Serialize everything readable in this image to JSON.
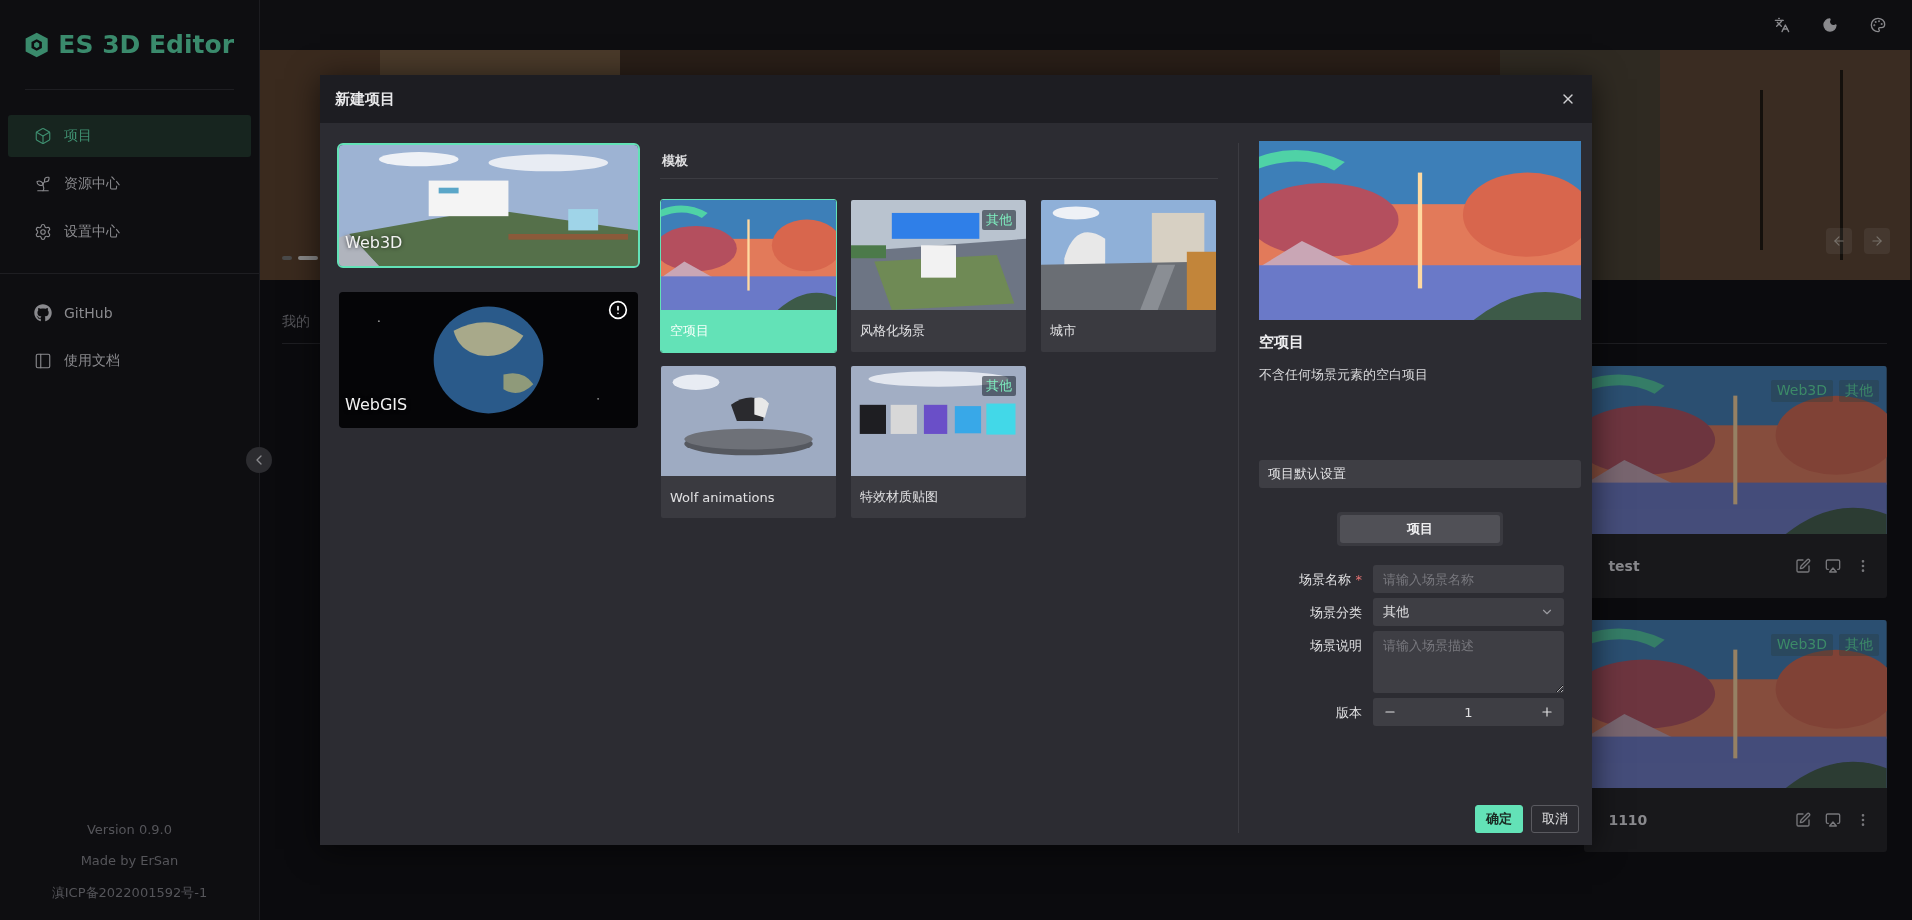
{
  "sidebar": {
    "logo_text": "ES 3D Editor",
    "items": [
      {
        "label": "项目",
        "selected": true
      },
      {
        "label": "资源中心",
        "selected": false
      },
      {
        "label": "设置中心",
        "selected": false
      }
    ],
    "links": [
      {
        "label": "GitHub"
      },
      {
        "label": "使用文档"
      }
    ],
    "footer": [
      "Version 0.9.0",
      "Made by ErSan",
      "滇ICP备2022001592号-1"
    ]
  },
  "banner": {
    "dots": [
      {
        "selected": false
      },
      {
        "selected": true
      }
    ]
  },
  "page_tab": {
    "label": "我的"
  },
  "projects": [
    {
      "name": "test",
      "tags": [
        "Web3D",
        "其他"
      ]
    },
    {
      "name": "1110",
      "tags": [
        "Web3D",
        "其他"
      ]
    }
  ],
  "modal": {
    "title": "新建项目",
    "types": [
      {
        "label": "Web3D",
        "selected": true,
        "info": false
      },
      {
        "label": "WebGIS",
        "selected": false,
        "info": true
      }
    ],
    "templates_heading": "模板",
    "templates": [
      {
        "label": "空项目",
        "selected": true
      },
      {
        "label": "风格化场景",
        "selected": false,
        "tag": "其他"
      },
      {
        "label": "城市",
        "selected": false
      },
      {
        "label": "Wolf animations",
        "selected": false
      },
      {
        "label": "特效材质贴图",
        "selected": false,
        "tag": "其他"
      }
    ],
    "preview": {
      "title": "空项目",
      "description": "不含任何场景元素的空白项目"
    },
    "settings_heading": "项目默认设置",
    "settings_tabs": [
      {
        "label": "项目",
        "selected": true
      }
    ],
    "form": [
      {
        "kind": "input",
        "label": "场景名称",
        "mark": "*",
        "placeholder": "请输入场景名称"
      },
      {
        "kind": "select",
        "label": "场景分类",
        "value": "其他"
      },
      {
        "kind": "textarea",
        "label": "场景说明",
        "placeholder": "请输入场景描述"
      },
      {
        "kind": "number",
        "label": "版本",
        "value": "1"
      }
    ],
    "buttons": [
      {
        "label": "确定",
        "kind": "primary"
      },
      {
        "label": "取消",
        "kind": "default"
      }
    ]
  }
}
